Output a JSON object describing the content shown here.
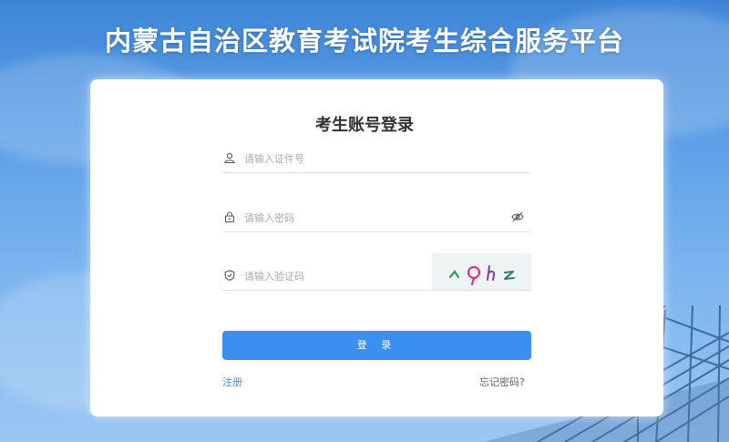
{
  "header": {
    "title": "内蒙古自治区教育考试院考生综合服务平台"
  },
  "login": {
    "title": "考生账号登录",
    "id_field": {
      "placeholder": "请输入证件号",
      "icon": "user-icon"
    },
    "password_field": {
      "placeholder": "请输入密码",
      "icon": "lock-icon",
      "toggle_icon": "eye-off-icon"
    },
    "captcha_field": {
      "placeholder": "请输入验证码",
      "icon": "shield-icon",
      "captcha_text": "^ρhz"
    },
    "submit_label": "登 录",
    "register_label": "注册",
    "forgot_label": "忘记密码?"
  },
  "colors": {
    "accent": "#3c8ef0",
    "title_text": "#333333",
    "background_top": "#3f86d8"
  }
}
